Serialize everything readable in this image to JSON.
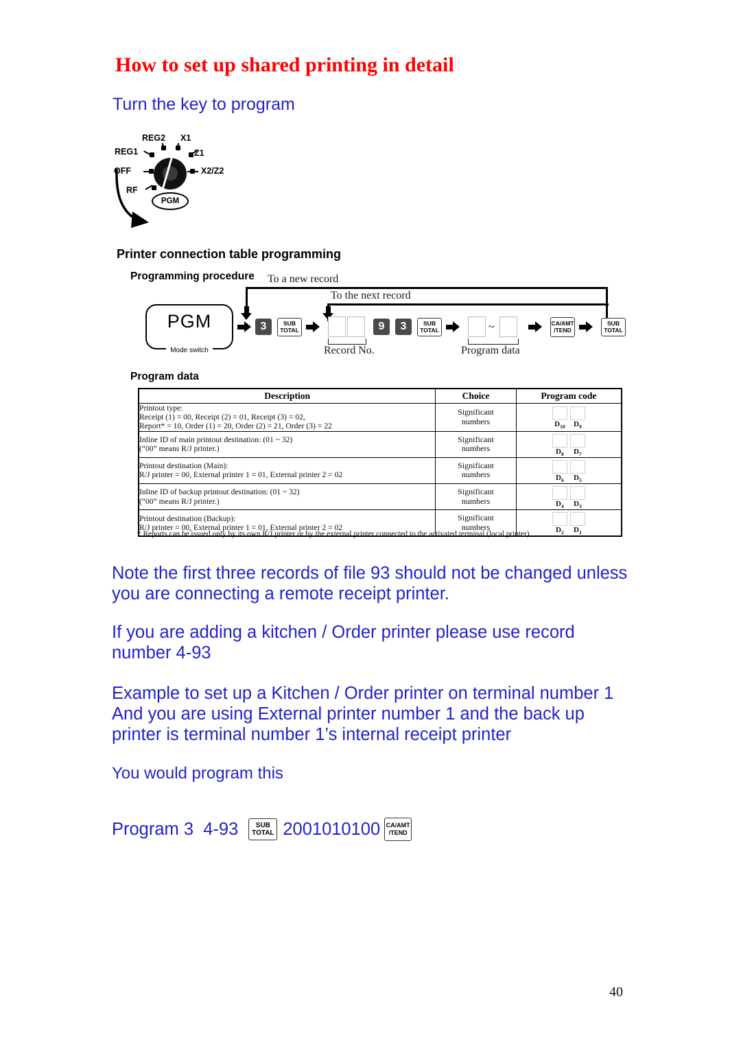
{
  "page": {
    "title": "How to set up shared printing in detail",
    "subtitle": "Turn the key to program",
    "page_number": "40",
    "title_color": "#ff0000",
    "body_color": "#2222cc"
  },
  "key_switch": {
    "labels": {
      "reg1": "REG1",
      "reg2": "REG2",
      "x1": "X1",
      "z1": "Z1",
      "off": "OFF",
      "x2z2": "X2/Z2",
      "rf": "RF",
      "pgm": "PGM"
    }
  },
  "printer_section": {
    "heading": "Printer connection table programming",
    "procedure_heading": "Programming procedure",
    "program_data_heading": "Program data"
  },
  "flow": {
    "loop_top_label": "To a new record",
    "loop_second_label": "To the next record",
    "mode_box": "PGM",
    "mode_caption": "Mode switch",
    "key_3a": "3",
    "key_subtotal_1": "SUB\nTOTAL",
    "key_9": "9",
    "key_3b": "3",
    "key_subtotal_2": "SUB\nTOTAL",
    "key_catend": "CA/AMT\n/TEND",
    "key_subtotal_3": "SUB\nTOTAL",
    "record_no_label": "Record No.",
    "program_data_label": "Program data",
    "tilde": "~",
    "subtotal_line1": "SUB",
    "subtotal_line2": "TOTAL",
    "catend_line1": "CA/AMT",
    "catend_line2": "/TEND"
  },
  "table": {
    "headers": [
      "Description",
      "Choice",
      "Program code"
    ],
    "rows": [
      {
        "description": [
          "Printout type:",
          "Receipt (1) = 00, Receipt (2) = 01, Receipt (3) = 02,",
          "Report* = 10, Order (1) = 20, Order (2) = 21, Order (3) = 22"
        ],
        "choice": [
          "Significant",
          "numbers"
        ],
        "code_labels": [
          "D10",
          "D9"
        ],
        "code_subs": [
          [
            "D",
            "10"
          ],
          [
            "D",
            "9"
          ]
        ]
      },
      {
        "description": [
          "Inline ID of main printout destination: (01 ~ 32)",
          "(“00” means R/J printer.)"
        ],
        "choice": [
          "Significant",
          "numbers"
        ],
        "code_labels": [
          "D8",
          "D7"
        ],
        "code_subs": [
          [
            "D",
            "8"
          ],
          [
            "D",
            "7"
          ]
        ]
      },
      {
        "description": [
          "Printout destination (Main):",
          "R/J printer = 00, External printer 1 = 01, External printer 2 = 02"
        ],
        "choice": [
          "Significant",
          "numbers"
        ],
        "code_labels": [
          "D6",
          "D5"
        ],
        "code_subs": [
          [
            "D",
            "6"
          ],
          [
            "D",
            "5"
          ]
        ]
      },
      {
        "description": [
          "Inline ID of backup printout destination: (01 ~ 32)",
          "(“00” means R/J printer.)"
        ],
        "choice": [
          "Significant",
          "numbers"
        ],
        "code_labels": [
          "D4",
          "D3"
        ],
        "code_subs": [
          [
            "D",
            "4"
          ],
          [
            "D",
            "3"
          ]
        ]
      },
      {
        "description": [
          "Printout destination (Backup):",
          "R/J printer = 00, External printer 1 = 01, External printer 2 = 02"
        ],
        "choice": [
          "Significant",
          "numbers"
        ],
        "code_labels": [
          "D2",
          "D1"
        ],
        "code_subs": [
          [
            "D",
            "2"
          ],
          [
            "D",
            "1"
          ]
        ]
      }
    ],
    "footnote": "* Reports can be issued only by its own R/J printer or by the external printer connected to the activated terminal (local printer)."
  },
  "paragraphs": {
    "note": "Note the first three records of file 93 should not be changed unless you are connecting a remote receipt printer.",
    "kitchen": "If you are adding a kitchen / Order printer please use record number 4-93",
    "example": "Example to set up a Kitchen / Order printer on terminal number 1 And you are using External printer number 1 and the back up printer is terminal number 1’s internal receipt printer",
    "would_program": "You would program this"
  },
  "program_line": {
    "prefix": "Program 3  4-93 ",
    "subtotal_line1": "SUB",
    "subtotal_line2": "TOTAL",
    "data": "2001010100",
    "catend_line1": "CA/AMT",
    "catend_line2": "/TEND"
  }
}
